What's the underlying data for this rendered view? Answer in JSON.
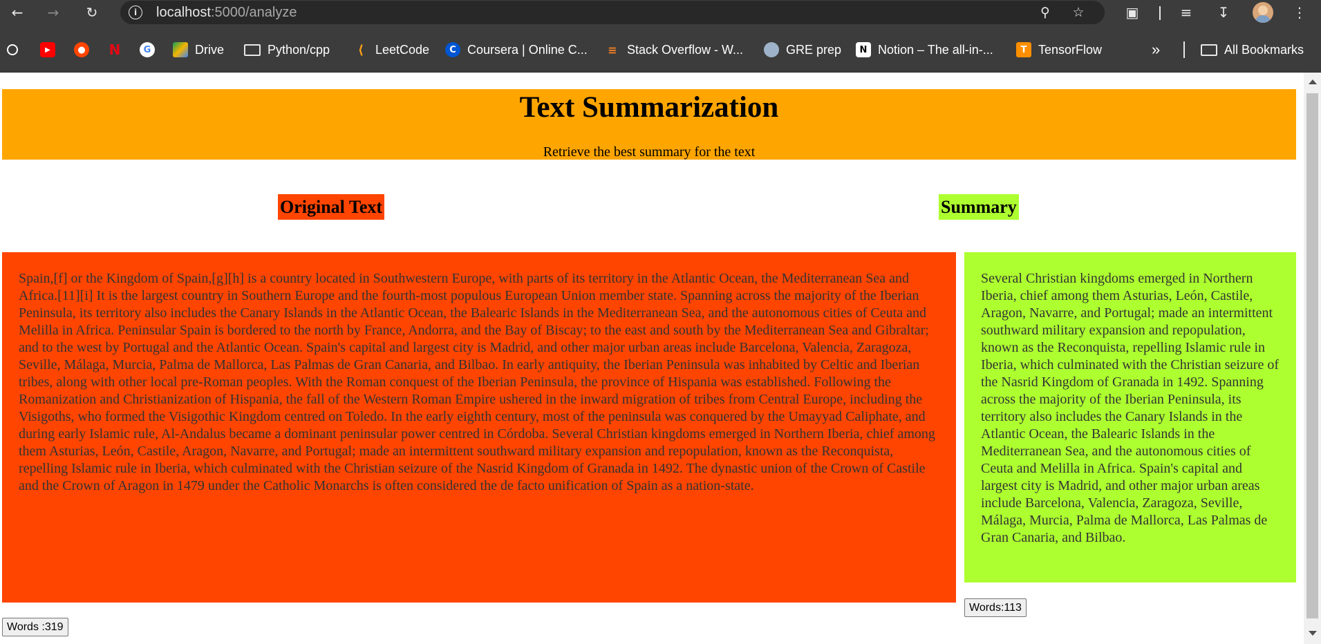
{
  "browser": {
    "url_host": "localhost",
    "url_path": ":5000/analyze",
    "bookmarks": [
      {
        "label": ""
      },
      {
        "label": ""
      },
      {
        "label": ""
      },
      {
        "label": ""
      },
      {
        "label": ""
      },
      {
        "label": "Drive"
      },
      {
        "label": "Python/cpp"
      },
      {
        "label": "LeetCode"
      },
      {
        "label": "Coursera | Online C..."
      },
      {
        "label": "Stack Overflow - W..."
      },
      {
        "label": "GRE prep"
      },
      {
        "label": "Notion – The all-in-..."
      },
      {
        "label": "TensorFlow"
      }
    ],
    "overflow_label": "»",
    "all_bookmarks": "All Bookmarks"
  },
  "page": {
    "title": "Text Summarization",
    "subtitle": "Retrieve the best summary for the text",
    "original_heading": "Original Text",
    "summary_heading": "Summary",
    "original_text": "Spain,[f] or the Kingdom of Spain,[g][h] is a country located in Southwestern Europe, with parts of its territory in the Atlantic Ocean, the Mediterranean Sea and Africa.[11][i] It is the largest country in Southern Europe and the fourth-most populous European Union member state. Spanning across the majority of the Iberian Peninsula, its territory also includes the Canary Islands in the Atlantic Ocean, the Balearic Islands in the Mediterranean Sea, and the autonomous cities of Ceuta and Melilla in Africa. Peninsular Spain is bordered to the north by France, Andorra, and the Bay of Biscay; to the east and south by the Mediterranean Sea and Gibraltar; and to the west by Portugal and the Atlantic Ocean. Spain's capital and largest city is Madrid, and other major urban areas include Barcelona, Valencia, Zaragoza, Seville, Málaga, Murcia, Palma de Mallorca, Las Palmas de Gran Canaria, and Bilbao. In early antiquity, the Iberian Peninsula was inhabited by Celtic and Iberian tribes, along with other local pre-Roman peoples. With the Roman conquest of the Iberian Peninsula, the province of Hispania was established. Following the Romanization and Christianization of Hispania, the fall of the Western Roman Empire ushered in the inward migration of tribes from Central Europe, including the Visigoths, who formed the Visigothic Kingdom centred on Toledo. In the early eighth century, most of the peninsula was conquered by the Umayyad Caliphate, and during early Islamic rule, Al-Andalus became a dominant peninsular power centred in Córdoba. Several Christian kingdoms emerged in Northern Iberia, chief among them Asturias, León, Castile, Aragon, Navarre, and Portugal; made an intermittent southward military expansion and repopulation, known as the Reconquista, repelling Islamic rule in Iberia, which culminated with the Christian seizure of the Nasrid Kingdom of Granada in 1492. The dynastic union of the Crown of Castile and the Crown of Aragon in 1479 under the Catholic Monarchs is often considered the de facto unification of Spain as a nation-state.",
    "summary_text": "Several Christian kingdoms emerged in Northern Iberia, chief among them Asturias, León, Castile, Aragon, Navarre, and Portugal; made an intermittent southward military expansion and repopulation, known as the Reconquista, repelling Islamic rule in Iberia, which culminated with the Christian seizure of the Nasrid Kingdom of Granada in 1492. Spanning across the majority of the Iberian Peninsula, its territory also includes the Canary Islands in the Atlantic Ocean, the Balearic Islands in the Mediterranean Sea, and the autonomous cities of Ceuta and Melilla in Africa. Spain's capital and largest city is Madrid, and other major urban areas include Barcelona, Valencia, Zaragoza, Seville, Málaga, Murcia, Palma de Mallorca, Las Palmas de Gran Canaria, and Bilbao.",
    "original_count": "Words :319",
    "summary_count": "Words:113"
  },
  "colors": {
    "header_bg": "#ffa500",
    "original_bg": "#ff4500",
    "summary_bg": "#adff2f"
  }
}
